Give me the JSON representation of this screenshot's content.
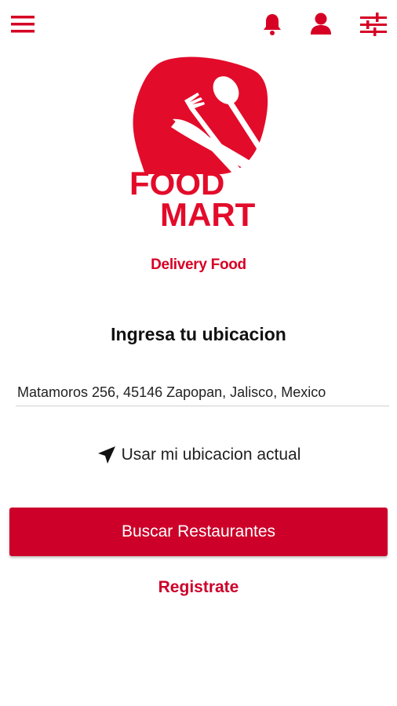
{
  "header": {
    "menu_icon": "hamburger-menu-icon",
    "notifications_icon": "bell-icon",
    "profile_icon": "user-icon",
    "filters_icon": "sliders-icon"
  },
  "logo": {
    "word1": "FOOD",
    "word2": "MART",
    "tagline": "Delivery Food"
  },
  "location": {
    "heading": "Ingresa tu ubicacion",
    "address_value": "Matamoros 256, 45146 Zapopan, Jalisco, Mexico",
    "use_current_label": "Usar mi ubicacion actual",
    "use_current_icon": "navigation-arrow-icon"
  },
  "actions": {
    "search_label": "Buscar Restaurantes",
    "register_label": "Registrate"
  },
  "colors": {
    "brand_red": "#d60024",
    "button_red": "#cc0029",
    "logo_yellow": "#f6d300"
  }
}
